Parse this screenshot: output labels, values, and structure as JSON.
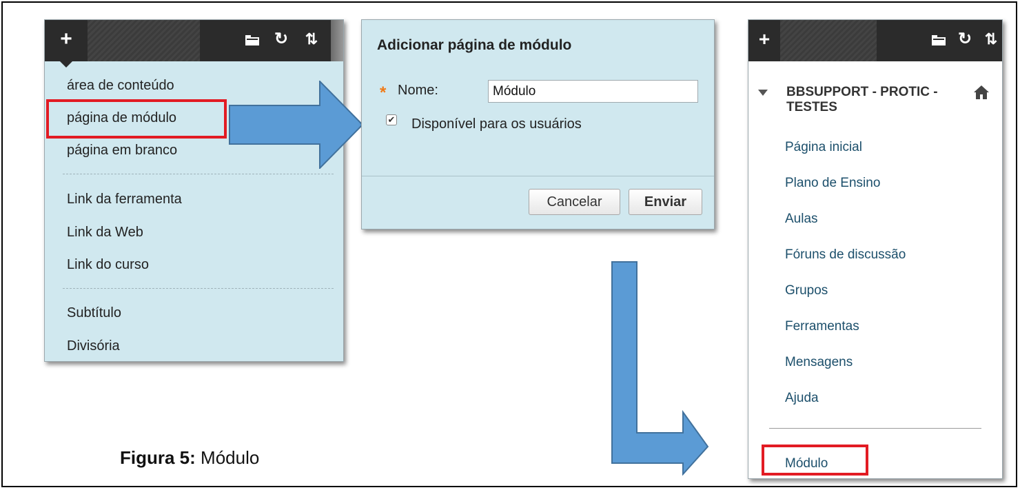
{
  "caption": {
    "label": "Figura 5:",
    "text": "Módulo"
  },
  "add_menu": {
    "toolbar_plus": "+",
    "items": [
      "área de conteúdo",
      "página de módulo",
      "página em branco",
      "Link da ferramenta",
      "Link da Web",
      "Link do curso",
      "Subtítulo",
      "Divisória"
    ],
    "highlighted_item": "página de módulo"
  },
  "dialog": {
    "title": "Adicionar página de módulo",
    "required_marker": "*",
    "name_label": "Nome:",
    "name_value": "Módulo",
    "available_checked": true,
    "available_label": "Disponível para os usuários",
    "cancel_label": "Cancelar",
    "submit_label": "Enviar"
  },
  "course_menu": {
    "toolbar_plus": "+",
    "course_title": "BBSUPPORT - PROTIC - TESTES",
    "items": [
      "Página inicial",
      "Plano de Ensino",
      "Aulas",
      "Fóruns de discussão",
      "Grupos",
      "Ferramentas",
      "Mensagens",
      "Ajuda"
    ],
    "new_item": "Módulo"
  },
  "colors": {
    "panel_bg": "#d0e8ef",
    "toolbar_bg": "#2b2b2b",
    "highlight_border": "#e21b23",
    "arrow_fill": "#5b9bd5",
    "required_star": "#f07a17",
    "link_text": "#1c4f6b"
  }
}
